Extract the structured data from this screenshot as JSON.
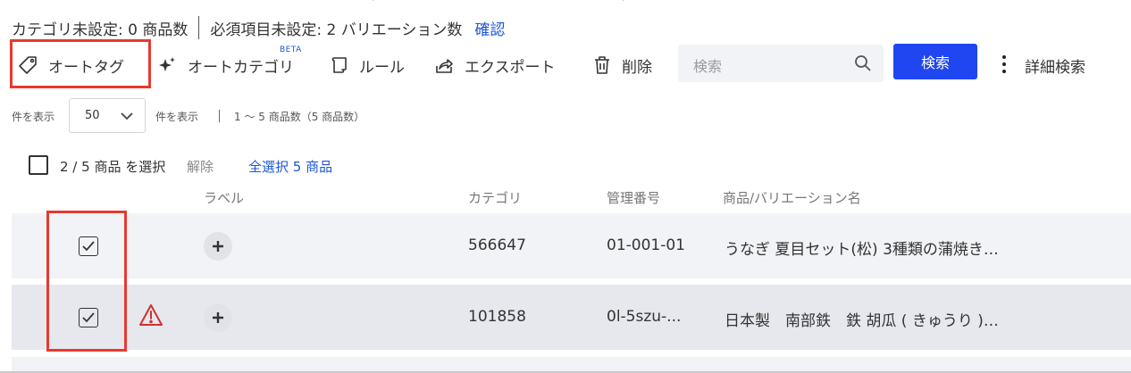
{
  "status_bar": {
    "category_unset": "カテゴリ未設定: 0 商品数",
    "required_unset": "必須項目未設定: 2 バリエーション数",
    "confirm_link": "確認"
  },
  "toolbar": {
    "auto_tag": "オートタグ",
    "auto_category": "オートカテゴリ",
    "beta_badge": "BETA",
    "rules": "ルール",
    "export": "エクスポート",
    "delete": "削除",
    "search_placeholder": "検索",
    "search_button": "検索",
    "advanced_search": "詳細検索"
  },
  "pagination": {
    "show_label": "件を表示",
    "per_page_value": "50",
    "show_label_after": "件を表示",
    "range_text": "1 〜 5 商品数（5 商品数）"
  },
  "selection": {
    "selected_text": "2 / 5 商品 を選択",
    "clear": "解除",
    "select_all": "全選択 5 商品"
  },
  "table": {
    "headers": [
      "ラベル",
      "カテゴリ",
      "管理番号",
      "商品/バリエーション名"
    ],
    "rows": [
      {
        "checked": true,
        "warning": false,
        "category": "566647",
        "code": "01-001-01",
        "name": "うなぎ 夏目セット(松) 3種類の蒲焼き…"
      },
      {
        "checked": true,
        "warning": true,
        "category": "101858",
        "code": "0l-5szu-...",
        "name": "日本製　南部鉄　鉄 胡瓜 ( きゅうり )…"
      }
    ]
  },
  "colors": {
    "accent_blue": "#1f46f0",
    "link_blue": "#1e55d6",
    "highlight_red": "#e8392f",
    "warning_red": "#d32f2f"
  }
}
